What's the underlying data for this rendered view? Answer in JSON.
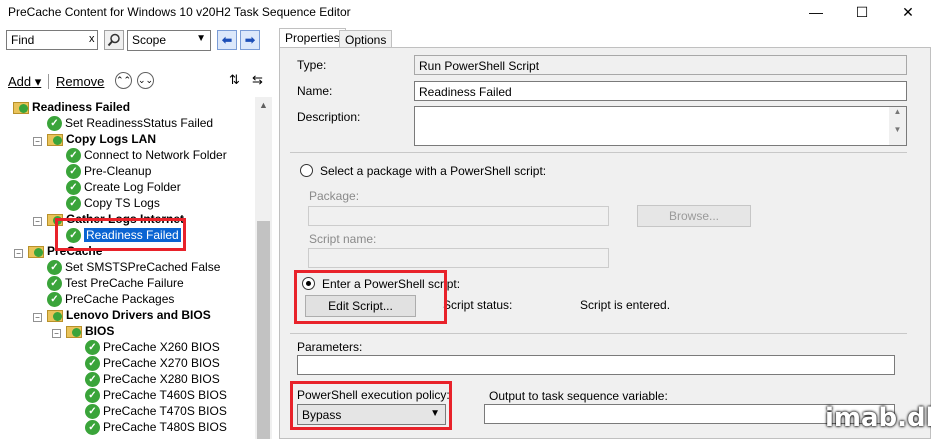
{
  "window": {
    "title": "PreCache Content for Windows 10 v20H2 Task Sequence Editor",
    "minimize": "—",
    "maximize": "☐",
    "close": "✕"
  },
  "toolbar": {
    "find_value": "Find",
    "find_clear": "x",
    "scope_value": "Scope",
    "add_label": "Add",
    "remove_label": "Remove"
  },
  "tree": {
    "nodes": [
      {
        "label": "Readiness Failed"
      },
      {
        "label": "Set ReadinessStatus Failed"
      },
      {
        "label": "Copy Logs LAN"
      },
      {
        "label": "Connect to Network Folder"
      },
      {
        "label": "Pre-Cleanup"
      },
      {
        "label": "Create Log Folder"
      },
      {
        "label": "Copy TS Logs"
      },
      {
        "label": "Gather Logs Internet"
      },
      {
        "label": "Readiness Failed"
      },
      {
        "label": "PreCache"
      },
      {
        "label": "Set SMSTSPreCached False"
      },
      {
        "label": "Test PreCache Failure"
      },
      {
        "label": "PreCache Packages"
      },
      {
        "label": "Lenovo Drivers and BIOS"
      },
      {
        "label": "BIOS"
      },
      {
        "label": "PreCache X260 BIOS"
      },
      {
        "label": "PreCache X270 BIOS"
      },
      {
        "label": "PreCache X280 BIOS"
      },
      {
        "label": "PreCache T460S BIOS"
      },
      {
        "label": "PreCache T470S BIOS"
      },
      {
        "label": "PreCache T480S BIOS"
      }
    ]
  },
  "tabs": [
    "Properties",
    "Options"
  ],
  "properties": {
    "type_label": "Type:",
    "type_value": "Run PowerShell Script",
    "name_label": "Name:",
    "name_value": "Readiness Failed",
    "description_label": "Description:",
    "description_value": "",
    "option_package": "Select a package with a PowerShell script:",
    "package_label": "Package:",
    "browse_label": "Browse...",
    "script_name_label": "Script name:",
    "option_enter": "Enter a PowerShell script:",
    "edit_script_label": "Edit Script...",
    "script_status_label": "Script status:",
    "script_status_value": "Script is entered.",
    "parameters_label": "Parameters:",
    "parameters_value": "",
    "policy_label": "PowerShell execution policy:",
    "policy_value": "Bypass",
    "output_label": "Output to task sequence variable:",
    "output_value": ""
  },
  "watermark": "imab.dk",
  "colors": {
    "highlight": "#e8222a",
    "selection": "#0a64d2",
    "success": "#3aa43a"
  }
}
